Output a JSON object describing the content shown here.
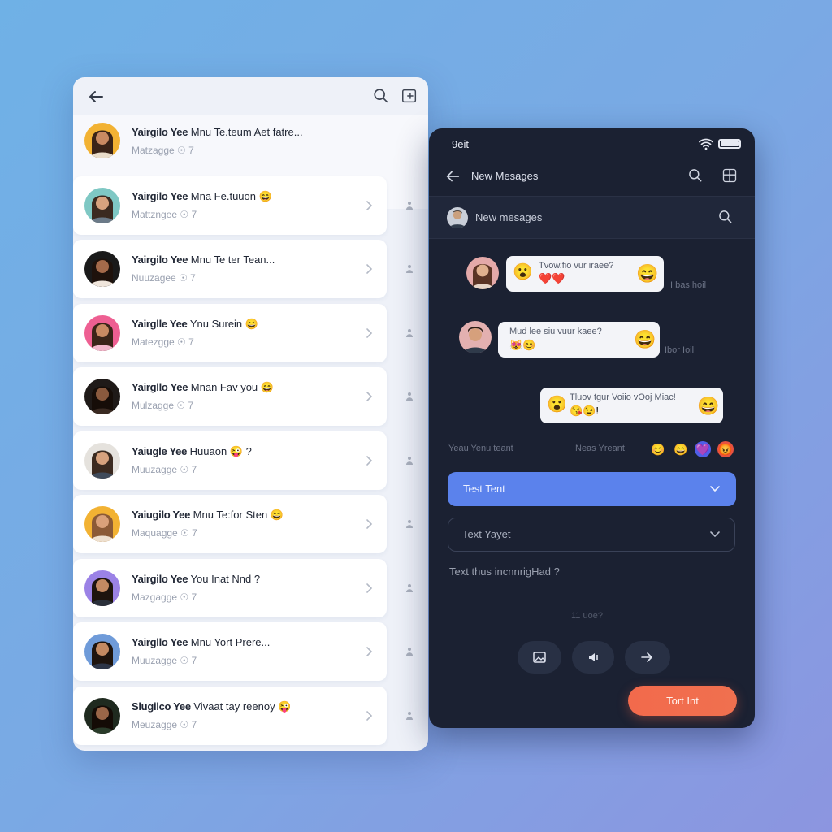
{
  "contacts": {
    "items": [
      {
        "name": "Yairgilo Yee",
        "preview": "Mnu Te.teum Aet fatre...",
        "sub": "Matzagge  ☉ 7",
        "avatar_bg": "#f2b233",
        "skin": "#c98a62",
        "hair": "#3a2418",
        "shirt": "#e9dcc9"
      },
      {
        "name": "Yairgilo Yee",
        "preview": "Mna Fe.tuuon 😄",
        "sub": "Mattzngee  ☉ 7",
        "avatar_bg": "#7fc8c4",
        "skin": "#d7a27e",
        "hair": "#3b2a20",
        "shirt": "#6b7a88"
      },
      {
        "name": "Yairgilo Yee",
        "preview": "Mnu Te ter Tean...",
        "sub": "Nuuzagee  ☉ 7",
        "avatar_bg": "#1a1a1a",
        "skin": "#a46a4a",
        "hair": "#1e120c",
        "shirt": "#f0e6dc"
      },
      {
        "name": "Yairglle Yee",
        "preview": "Ynu Surein 😄",
        "sub": "Matezgge  ☉ 7",
        "avatar_bg": "#ee5f92",
        "skin": "#c98a62",
        "hair": "#3a2418",
        "shirt": "#f2b7cb"
      },
      {
        "name": "Yairgllo Yee",
        "preview": "Mnan Fav you 😄",
        "sub": "Mulzagge  ☉ 7",
        "avatar_bg": "#1f1a18",
        "skin": "#8a5a3e",
        "hair": "#160d08",
        "shirt": "#3a2a22"
      },
      {
        "name": "Yaiugle Yee",
        "preview": "Huuaon 😜 ?",
        "sub": "Muuzagge  ☉ 7",
        "avatar_bg": "#e5e2dd",
        "skin": "#d7a27e",
        "hair": "#3b2a20",
        "shirt": "#3f4a5a"
      },
      {
        "name": "Yaiugilo Yee",
        "preview": "Mnu Te:for Sten 😄",
        "sub": "Maquagge  ☉ 7",
        "avatar_bg": "#f2b233",
        "skin": "#d9a17a",
        "hair": "#8b5a36",
        "shirt": "#eee0cf"
      },
      {
        "name": "Yairgilo Yee",
        "preview": "You Inat Nnd ?",
        "sub": "Mazgagge  ☉ 7",
        "avatar_bg": "#9b82e6",
        "skin": "#c48a62",
        "hair": "#1e140e",
        "shirt": "#2a2f3a"
      },
      {
        "name": "Yairgllo Yee",
        "preview": "Mnu Yort Prere...",
        "sub": "Muuzagge  ☉ 7",
        "avatar_bg": "#6f9bd9",
        "skin": "#c48a62",
        "hair": "#1e140e",
        "shirt": "#2d3547"
      },
      {
        "name": "Slugilco Yee",
        "preview": "Vivaat tay reenoy 😜",
        "sub": "Meuzagge  ☉ 7",
        "avatar_bg": "#1f2a1f",
        "skin": "#9a6648",
        "hair": "#140b06",
        "shirt": "#2a3b2a"
      }
    ]
  },
  "dark": {
    "status_time": "9eit",
    "title": "New Mesages",
    "subtitle": "New mesages",
    "messages": [
      {
        "text": "Tvow.fio vur iraee?",
        "meta": "I bas hoil"
      },
      {
        "text": "Mud lee siu vuur kaee?",
        "meta": "Ibor Ioil"
      },
      {
        "text": "Tluov tgur Voiio vOoj Miac!"
      }
    ],
    "react_left": "Yeau Yenu teant",
    "react_right": "Neas Yreant",
    "select_primary": "Test Tent",
    "select_secondary": "Text Yayet",
    "hint": "Text thus incnnrigHad ?",
    "count": "11 uoe?",
    "send": "Tort Int"
  },
  "emoji": {
    "grin": "😄",
    "wow": "😮",
    "hearts": "❤️",
    "kiss": "😘",
    "r1": "😊",
    "r2": "😄",
    "r3": "💜",
    "r4": "😡"
  }
}
